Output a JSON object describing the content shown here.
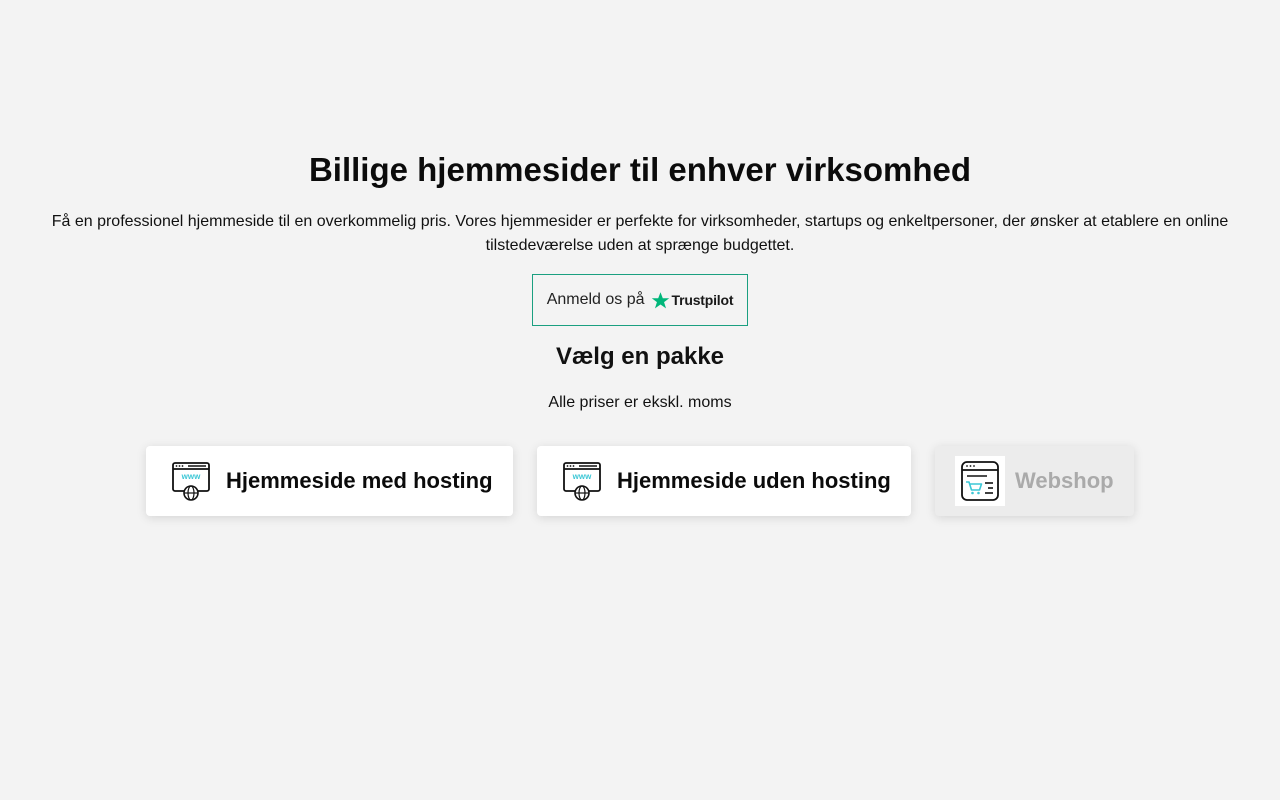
{
  "hero": {
    "title": "Billige hjemmesider til enhver virksomhed",
    "text_line1": "Få en professionel hjemmeside til en overkommelig pris. Vores hjemmesider er perfekte for virksomheder, startups og enkeltpersoner, der ønsker at etablere en online",
    "text_line2": "tilstedeværelse uden at sprænge budgettet."
  },
  "trustpilot": {
    "prefix": "Anmeld os på",
    "brand": "Trustpilot",
    "star_icon": "star-icon",
    "border_color": "#1a9f80",
    "star_color": "#00b67a"
  },
  "packages": {
    "title": "Vælg en pakke",
    "subtitle": "Alle priser er ekskl. moms",
    "items": [
      {
        "label": "Hjemmeside med hosting",
        "icon": "www-globe-icon",
        "active": true
      },
      {
        "label": "Hjemmeside uden hosting",
        "icon": "www-globe-icon",
        "active": true
      },
      {
        "label": "Webshop",
        "icon": "shopping-cart-browser-icon",
        "active": false
      }
    ],
    "accent_color": "#3cc7d6"
  }
}
